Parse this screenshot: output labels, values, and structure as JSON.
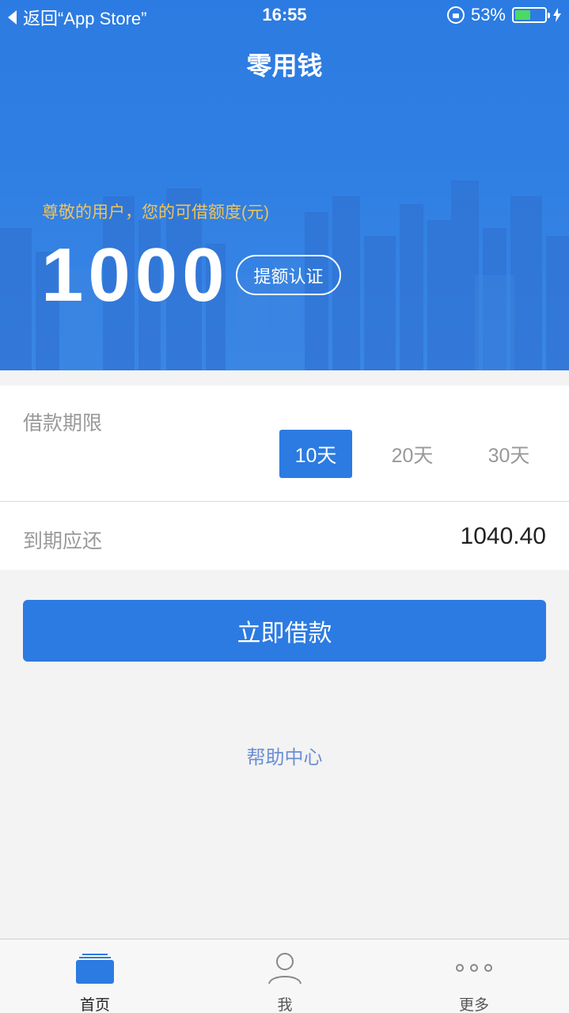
{
  "status_bar": {
    "back_label": "返回“App Store”",
    "time": "16:55",
    "battery": "53%",
    "battery_level": 0.53,
    "battery_color": "#4cd964"
  },
  "header": {
    "title": "零用钱"
  },
  "hero": {
    "greeting": "尊敬的用户，您的可借额度(元)",
    "limit_amount": "1000",
    "raise_button": "提额认证",
    "accent_color": "#2c7be2",
    "greeting_color": "#f0c35a"
  },
  "loan_term": {
    "label": "借款期限",
    "options": [
      {
        "label": "10天",
        "selected": true
      },
      {
        "label": "20天",
        "selected": false
      },
      {
        "label": "30天",
        "selected": false
      }
    ]
  },
  "due": {
    "label": "到期应还",
    "amount": "1040.40"
  },
  "actions": {
    "borrow_button": "立即借款",
    "help_link": "帮助中心"
  },
  "tab_bar": {
    "items": [
      {
        "label": "首页",
        "icon": "home-card-icon",
        "active": true
      },
      {
        "label": "我",
        "icon": "person-icon",
        "active": false
      },
      {
        "label": "更多",
        "icon": "more-dots-icon",
        "active": false
      }
    ]
  }
}
